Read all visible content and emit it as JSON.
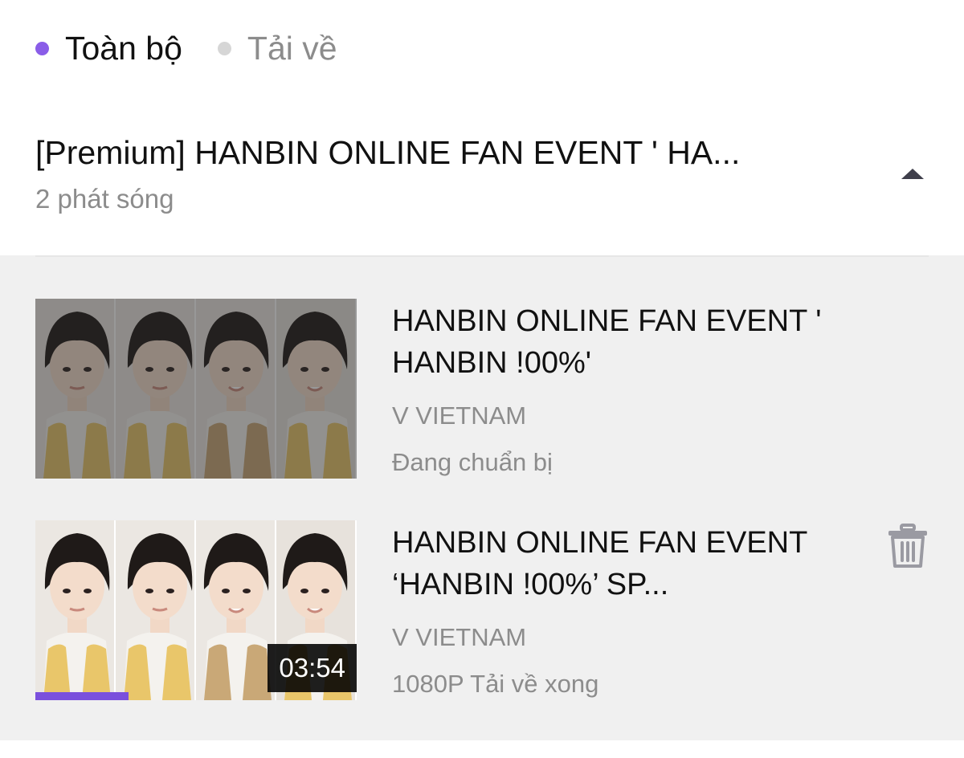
{
  "tabs": [
    {
      "label": "Toàn bộ",
      "active": true,
      "dot_color": "#8a5de8"
    },
    {
      "label": "Tải về",
      "active": false,
      "dot_color": "#d6d6d6"
    }
  ],
  "series": {
    "title": "[Premium] HANBIN ONLINE FAN EVENT ' HA...",
    "count": "2 phát sóng",
    "toggle_icon": "caret-up-icon"
  },
  "episodes": [
    {
      "title": "HANBIN ONLINE FAN EVENT ' HANBIN !00%'",
      "channel": "V VIETNAM",
      "status": "Đang chuẩn bị",
      "dimmed": true
    },
    {
      "title": "HANBIN ONLINE FAN EVENT ‘HANBIN !00%’ SP...",
      "channel": "V VIETNAM",
      "status": "1080P Tải về xong",
      "duration": "03:54",
      "watch_progress": 0.29,
      "action_icon": "trash-icon"
    }
  ],
  "colors": {
    "accent": "#7a50dd",
    "muted_text": "#8c8c8c",
    "panel_bg": "#f0f0f0"
  }
}
